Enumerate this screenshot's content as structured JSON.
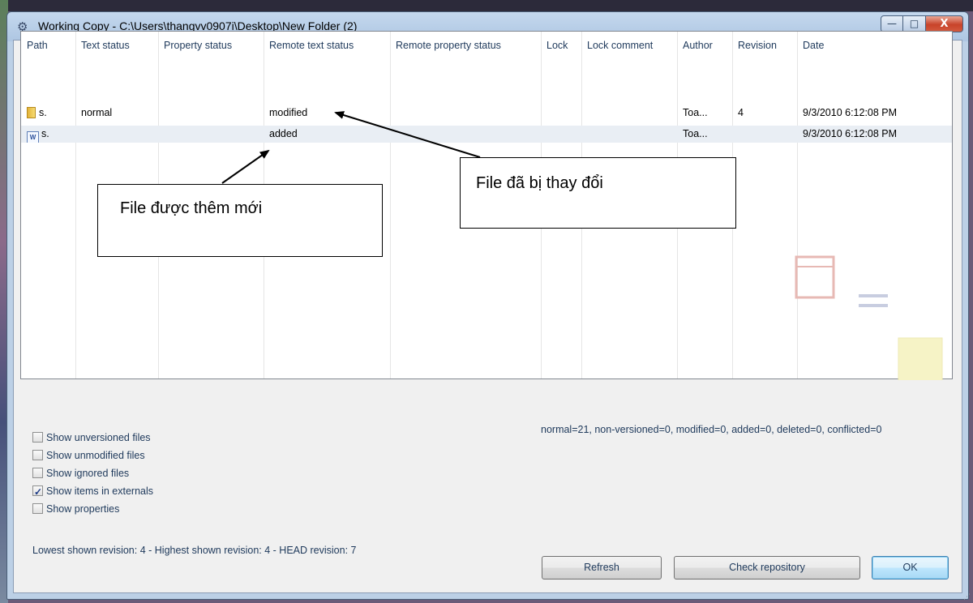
{
  "window": {
    "title": "Working Copy - C:\\Users\\thangvv0907i\\Desktop\\New Folder (2)",
    "minimize": "—",
    "maximize": "□",
    "close": "X"
  },
  "table": {
    "headers": [
      "Path",
      "Text status",
      "Property status",
      "Remote text status",
      "Remote property status",
      "Lock",
      "Lock comment",
      "Author",
      "Revision",
      "Date"
    ],
    "rows": [
      {
        "icon": "folder-icon",
        "path": "s.",
        "text_status": "normal",
        "property_status": "",
        "remote_text_status": "modified",
        "remote_property_status": "",
        "lock": "",
        "lock_comment": "",
        "author": "Toa...",
        "revision": "4",
        "date": "9/3/2010 6:12:08 PM"
      },
      {
        "icon": "word-document-icon",
        "path": "s.",
        "text_status": "",
        "property_status": "",
        "remote_text_status": "added",
        "remote_property_status": "",
        "lock": "",
        "lock_comment": "",
        "author": "Toa...",
        "revision": "",
        "date": "9/3/2010 6:12:08 PM"
      }
    ]
  },
  "annotations": {
    "added_callout": "File được thêm mới",
    "modified_callout": "File đã bị thay đổi"
  },
  "options": [
    {
      "label": "Show unversioned files",
      "checked": false
    },
    {
      "label": "Show unmodified files",
      "checked": false
    },
    {
      "label": "Show ignored files",
      "checked": false
    },
    {
      "label": "Show items in externals",
      "checked": true
    },
    {
      "label": "Show properties",
      "checked": false
    }
  ],
  "summary": "normal=21, non-versioned=0, modified=0, added=0, deleted=0, conflicted=0",
  "revision_info": "Lowest shown revision: 4 - Highest shown revision: 4 - HEAD revision: 7",
  "buttons": {
    "refresh": "Refresh",
    "check_repository": "Check repository",
    "ok": "OK"
  },
  "colors": {
    "window_frame": "#bcd0e6",
    "dialog_bg": "#f0f0f0",
    "close_button": "#c8432a",
    "header_text": "#1e395b"
  }
}
